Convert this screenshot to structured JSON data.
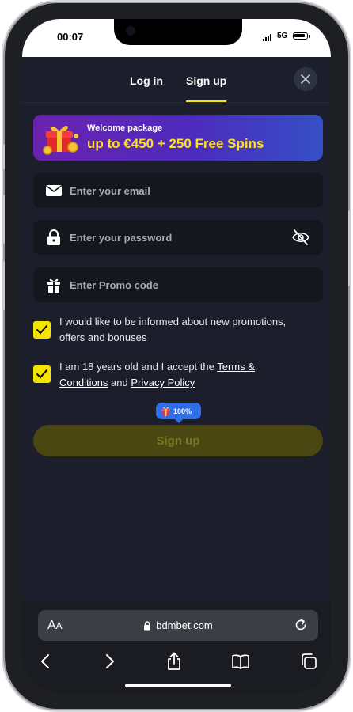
{
  "status_bar": {
    "time": "00:07",
    "network": "5G"
  },
  "tabs": {
    "login_label": "Log in",
    "signup_label": "Sign up",
    "active": "Sign up"
  },
  "promo": {
    "label": "Welcome package",
    "value": "up to €450 + 250 Free Spins"
  },
  "form": {
    "email_placeholder": "Enter your email",
    "password_placeholder": "Enter your password",
    "promo_placeholder": "Enter Promo code",
    "checkbox_marketing": {
      "checked": true,
      "text": "I would like to be informed about new promotions, offers and bonuses"
    },
    "checkbox_terms": {
      "checked": true,
      "text_before": "I am 18 years old and I accept the ",
      "terms_link": "Terms & Conditions",
      "text_middle": " and ",
      "privacy_link": "Privacy Policy"
    },
    "bonus_badge": "100%",
    "submit_label": "Sign up"
  },
  "browser": {
    "aa_large": "A",
    "aa_small": "A",
    "url": "bdmbet.com"
  },
  "colors": {
    "accent_yellow": "#f5e400",
    "background": "#1c1e2b",
    "field_bg": "#15171f",
    "badge_blue": "#2e6ee8"
  },
  "icons": [
    "close-icon",
    "gift-icon",
    "mail-icon",
    "lock-icon",
    "eye-off-icon",
    "check-icon",
    "back-icon",
    "forward-icon",
    "share-icon",
    "bookmarks-icon",
    "tabs-icon",
    "reload-icon"
  ]
}
